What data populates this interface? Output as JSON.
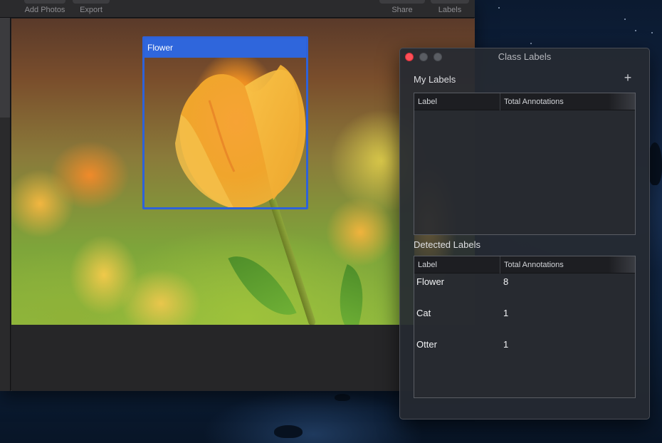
{
  "toolbar": {
    "add_photos_label": "Add Photos",
    "export_label": "Export",
    "share_label": "Share",
    "labels_label": "Labels"
  },
  "annotation": {
    "label": "Flower"
  },
  "panel": {
    "title": "Class Labels",
    "my_labels": {
      "title": "My Labels",
      "add_icon": "+",
      "columns": [
        "Label",
        "Total Annotations"
      ],
      "rows": []
    },
    "detected_labels": {
      "title": "Detected Labels",
      "columns": [
        "Label",
        "Total Annotations"
      ],
      "rows": [
        {
          "label": "Flower",
          "total": "8"
        },
        {
          "label": "Cat",
          "total": "1"
        },
        {
          "label": "Otter",
          "total": "1"
        }
      ]
    }
  },
  "colors": {
    "annotation_accent": "#2f66dc",
    "close_button": "#fe4f57"
  }
}
